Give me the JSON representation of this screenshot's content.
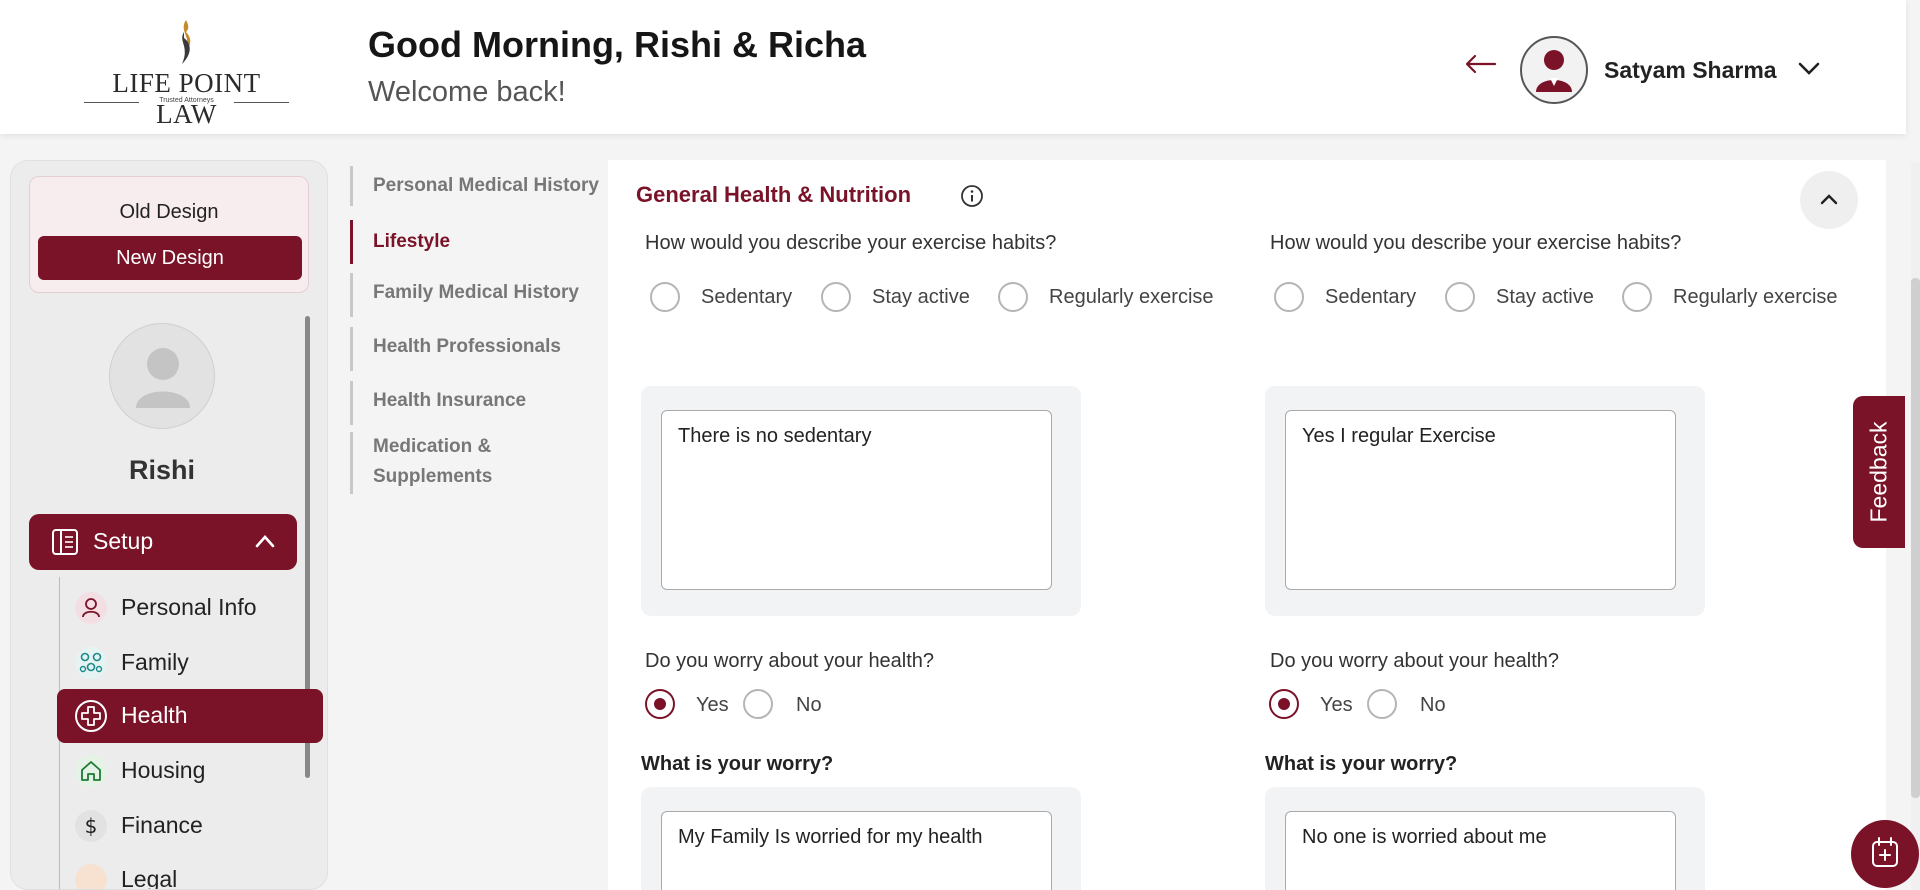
{
  "brand": {
    "name": "LIFE POINT LAW",
    "tagline": "Trusted Attorneys"
  },
  "header": {
    "greeting": "Good Morning, Rishi & Richa",
    "subtitle": "Welcome back!",
    "user_name": "Satyam Sharma"
  },
  "sidebar": {
    "old_design": "Old Design",
    "new_design": "New Design",
    "profile_name": "Rishi",
    "setup_label": "Setup",
    "items": [
      {
        "label": "Personal Info",
        "icon": "person-icon"
      },
      {
        "label": "Family",
        "icon": "family-icon"
      },
      {
        "label": "Health",
        "icon": "health-cross-icon",
        "active": true
      },
      {
        "label": "Housing",
        "icon": "home-icon"
      },
      {
        "label": "Finance",
        "icon": "dollar-icon"
      },
      {
        "label": "Legal",
        "icon": "legal-icon"
      }
    ]
  },
  "section_nav": [
    {
      "label": "Personal Medical History"
    },
    {
      "label": "Lifestyle",
      "active": true
    },
    {
      "label": "Family Medical History"
    },
    {
      "label": "Health Professionals"
    },
    {
      "label": "Health Insurance"
    },
    {
      "label": "Medication & Supplements"
    }
  ],
  "main": {
    "title": "General Health & Nutrition",
    "columns": [
      {
        "exercise_question": "How would you describe your exercise habits?",
        "exercise_options": [
          "Sedentary",
          "Stay active",
          "Regularly exercise"
        ],
        "exercise_text": "There is no sedentary",
        "worry_question": "Do you worry about your health?",
        "worry_options": [
          "Yes",
          "No"
        ],
        "worry_selected": "Yes",
        "worry_text_label": "What is your worry?",
        "worry_text": "My Family Is worried for my health"
      },
      {
        "exercise_question": "How would you describe your exercise habits?",
        "exercise_options": [
          "Sedentary",
          "Stay active",
          "Regularly exercise"
        ],
        "exercise_text": "Yes I regular Exercise",
        "worry_question": "Do you worry about your health?",
        "worry_options": [
          "Yes",
          "No"
        ],
        "worry_selected": "Yes",
        "worry_text_label": "What is your worry?",
        "worry_text": "No one is worried about me"
      }
    ]
  },
  "feedback_label": "Feedback",
  "colors": {
    "accent": "#7a1228"
  }
}
